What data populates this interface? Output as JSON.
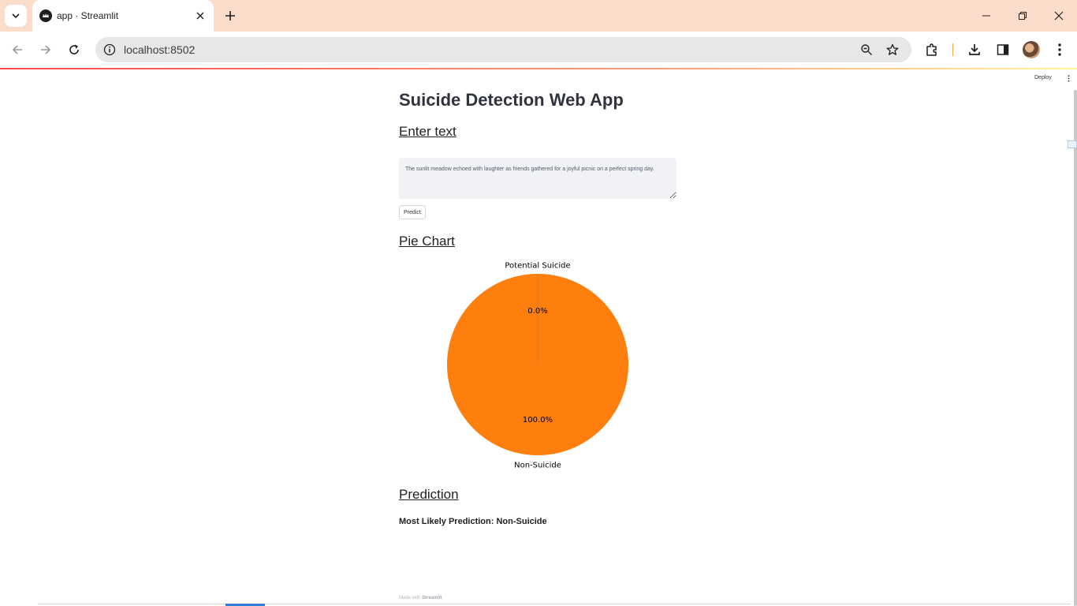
{
  "browser": {
    "tab_title": "app · Streamlit",
    "url": "localhost:8502"
  },
  "app": {
    "deploy_label": "Deploy",
    "title": "Suicide Detection Web App",
    "enter_text_heading": "Enter text",
    "input_value": "The sunlit meadow echoed with laughter as friends gathered for a joyful picnic on a perfect spring day.",
    "predict_label": "Predict",
    "pie_heading": "Pie Chart",
    "prediction_heading": "Prediction",
    "prediction_result": "Most Likely Prediction: Non-Suicide",
    "footer_prefix": "Made with",
    "footer_brand": "Streamlit"
  },
  "chart_data": {
    "type": "pie",
    "categories": [
      "Potential Suicide",
      "Non-Suicide"
    ],
    "values": [
      0.0,
      100.0
    ],
    "percent_labels": [
      "0.0%",
      "100.0%"
    ],
    "colors": [
      "#1f77b4",
      "#ff7f0e"
    ]
  }
}
